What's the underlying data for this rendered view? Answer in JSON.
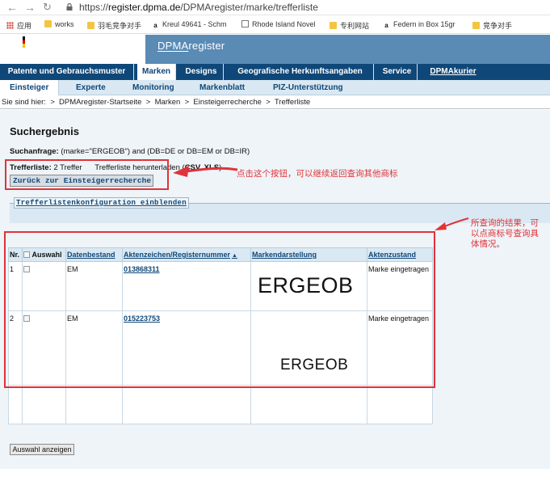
{
  "browser": {
    "url_prefix": "https://",
    "url_host": "register.dpma.de",
    "url_path": "/DPMAregister/marke/trefferliste",
    "bookmarks": [
      {
        "label": "应用",
        "icon": "apps-grid-icon"
      },
      {
        "label": "works",
        "icon": "folder-icon"
      },
      {
        "label": "羽毛竞争对手",
        "icon": "folder-icon"
      },
      {
        "label": "Kreul 49641 - Schm",
        "icon": "amazon-icon"
      },
      {
        "label": "Rhode Island Novel",
        "icon": "page-icon"
      },
      {
        "label": "专利网站",
        "icon": "folder-icon"
      },
      {
        "label": "Federn in Box 15gr",
        "icon": "amazon-icon"
      },
      {
        "label": "竞争对手",
        "icon": "folder-icon"
      }
    ]
  },
  "site": {
    "logo_dpma": "DPMA",
    "logo_register": "register"
  },
  "mainnav": [
    {
      "label": "Patente und Gebrauchsmuster"
    },
    {
      "label": "Marken"
    },
    {
      "label": "Designs"
    },
    {
      "label": "Geografische Herkunftsangaben"
    },
    {
      "label": "Service"
    },
    {
      "label": "DPMAkurier"
    }
  ],
  "subnav": [
    {
      "label": "Einsteiger"
    },
    {
      "label": "Experte"
    },
    {
      "label": "Monitoring"
    },
    {
      "label": "Markenblatt"
    },
    {
      "label": "PIZ-Unterstützung"
    }
  ],
  "breadcrumb": {
    "prefix": "Sie sind hier:",
    "sep": ">",
    "items": [
      "DPMAregister-Startseite",
      "Marken",
      "Einsteigerrecherche",
      "Trefferliste"
    ]
  },
  "result": {
    "title": "Suchergebnis",
    "query_label": "Suchanfrage:",
    "query_text": "(marke=\"ERGEOB\") and (DB=DE or DB=EM or DB=IR)",
    "hits_label": "Trefferliste:",
    "hits_count": "2 Treffer",
    "download_text": "Trefferliste herunterladen (",
    "download_format": "CSV, XLS",
    "download_close": ")",
    "back_button": "Zurück zur Einsteigerrecherche",
    "config_legend": "Trefferlistenkonfiguration einblenden",
    "show_selection_button": "Auswahl anzeigen"
  },
  "table": {
    "headers": {
      "nr": "Nr.",
      "auswahl": "Auswahl",
      "datenbestand": "Datenbestand",
      "aktenzeichen": "Aktenzeichen/Registernummer",
      "sort_icon": "▲",
      "markendarstellung": "Markendarstellung",
      "aktenzustand": "Aktenzustand"
    },
    "rows": [
      {
        "nr": "1",
        "datenbestand": "EM",
        "aktenzeichen": "013868311",
        "mark": "ERGEOB",
        "zustand": "Marke eingetragen"
      },
      {
        "nr": "2",
        "datenbestand": "EM",
        "aktenzeichen": "015223753",
        "mark": "ERGEOB",
        "zustand": "Marke eingetragen"
      }
    ]
  },
  "annotations": {
    "button_note": "点击这个按钮，可以继续返回查询其他商标",
    "result_note": "所查询的结果，可以点商标号查询具体情况。"
  },
  "colors": {
    "nav_dark": "#0f4778",
    "brand_bar": "#5a8bb5",
    "subnav_bg": "#d9e8f2",
    "content_bg": "#eef4f8",
    "annotation_red": "#e0333a"
  }
}
